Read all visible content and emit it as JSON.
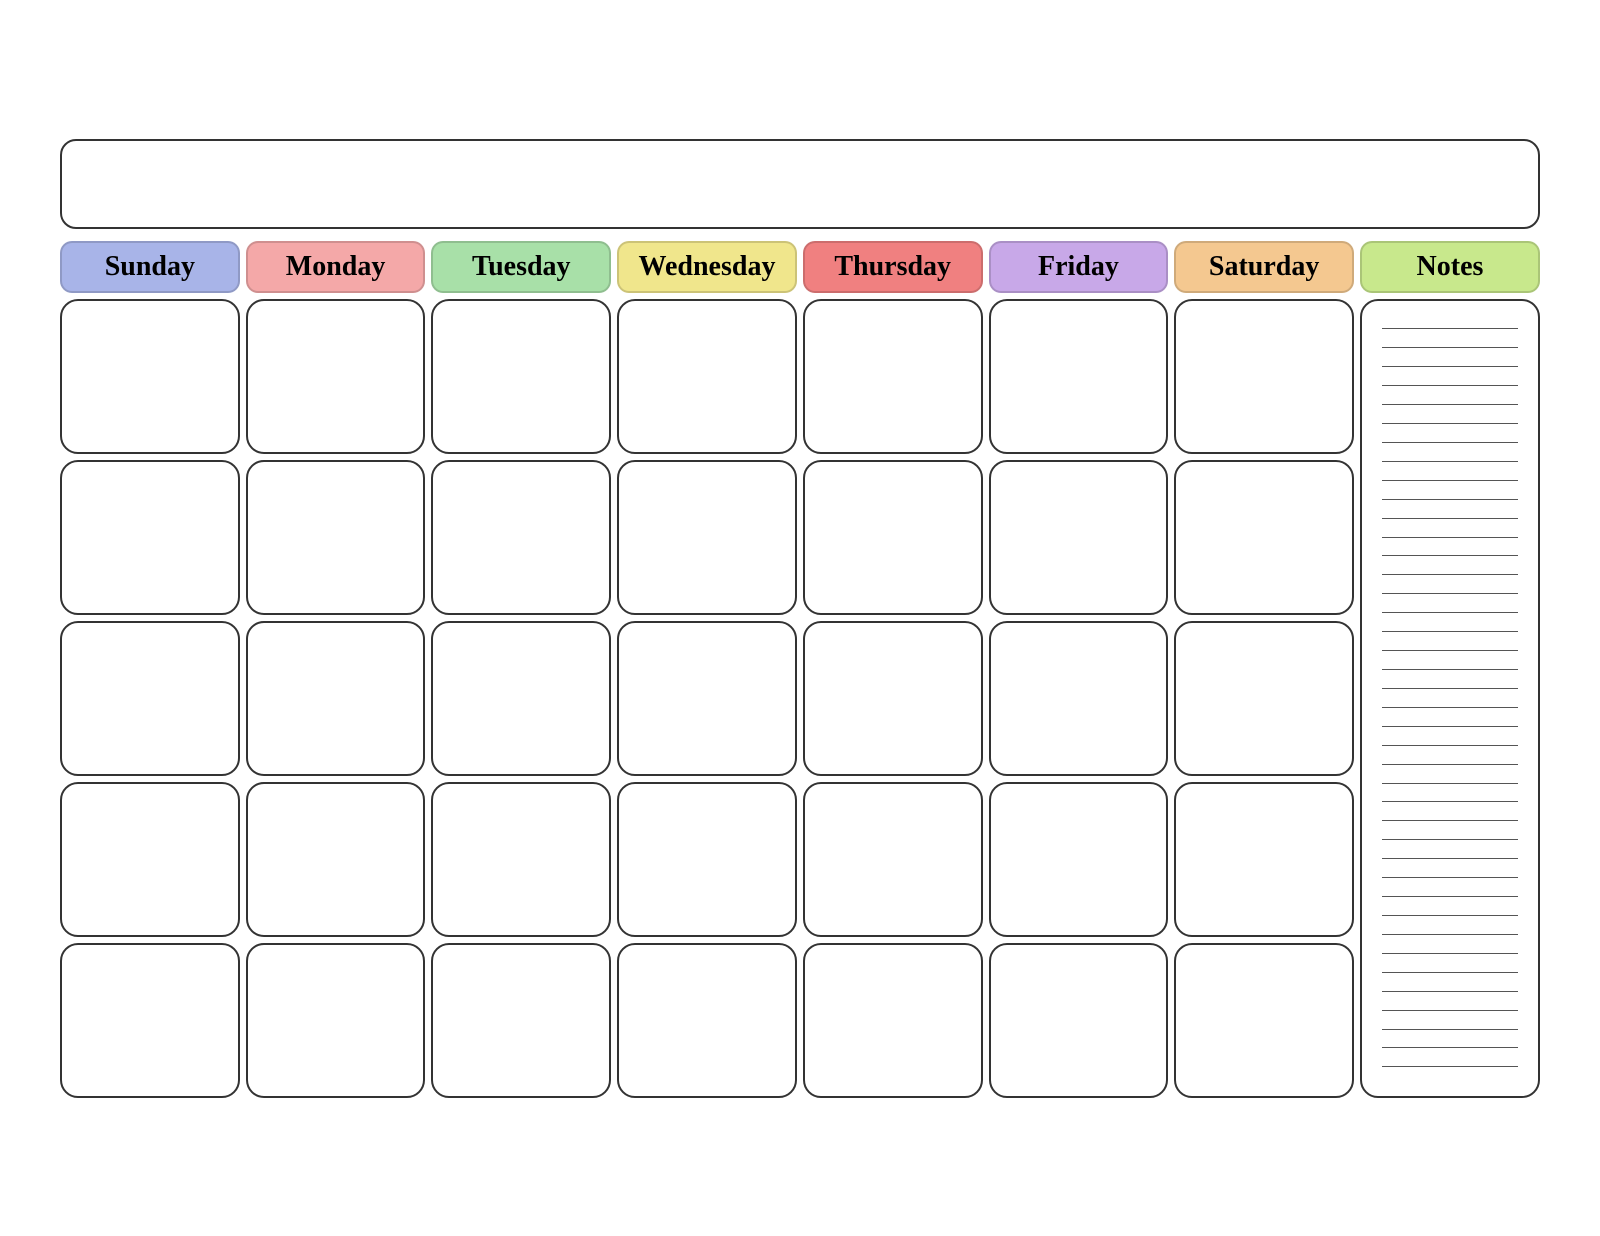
{
  "title": "",
  "days": [
    {
      "id": "sunday",
      "label": "Sunday",
      "colorClass": "header-sunday"
    },
    {
      "id": "monday",
      "label": "Monday",
      "colorClass": "header-monday"
    },
    {
      "id": "tuesday",
      "label": "Tuesday",
      "colorClass": "header-tuesday"
    },
    {
      "id": "wednesday",
      "label": "Wednesday",
      "colorClass": "header-wednesday"
    },
    {
      "id": "thursday",
      "label": "Thursday",
      "colorClass": "header-thursday"
    },
    {
      "id": "friday",
      "label": "Friday",
      "colorClass": "header-friday"
    },
    {
      "id": "saturday",
      "label": "Saturday",
      "colorClass": "header-saturday"
    }
  ],
  "notes_label": "Notes",
  "rows": 5,
  "notes_lines": 40
}
